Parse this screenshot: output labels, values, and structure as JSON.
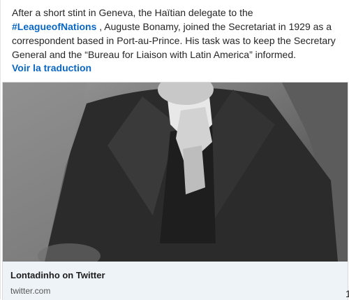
{
  "post": {
    "text_before": "After a short stint in Geneva, the Haïtian delegate to the ",
    "hashtag": "#LeagueofNations",
    "text_after": " , Auguste Bonamy, joined the Secretariat in 1929 as a correspondent based in Port-au-Prince. His task was to keep the Secretary General and the “Bureau for Liaison with Latin America” informed.",
    "translate_label": "Voir la traduction"
  },
  "card": {
    "title": "Lontadinho on Twitter",
    "domain": "twitter.com"
  },
  "edge_char": "1",
  "colors": {
    "link": "#0a66c2",
    "card_meta_bg": "#eef3f8"
  }
}
